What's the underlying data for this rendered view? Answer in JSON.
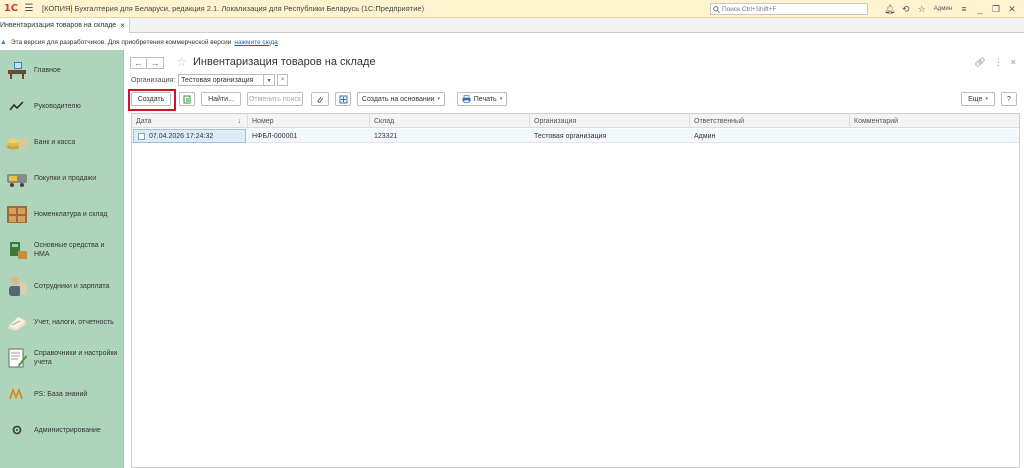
{
  "titlebar": {
    "logo_text": "1С",
    "title": "[КОПИЯ] Бухгалтерия для Беларуси, редакция 2.1. Локализация для Республики Беларусь  (1С:Предприятие)",
    "search_placeholder": "Поиск Ctrl+Shift+F",
    "user": "Админ"
  },
  "tabs": [
    {
      "label": "Инвентаризация товаров на складе"
    }
  ],
  "infobar": {
    "text": "Эта версия для разработчиков. Для приобретения коммерческой версии",
    "link": "нажмите сюда"
  },
  "sidebar": {
    "items": [
      {
        "label": "Главное",
        "icon": "desk-icon"
      },
      {
        "label": "Руководителю",
        "icon": "trend-icon"
      },
      {
        "label": "Банк и касса",
        "icon": "coins-icon"
      },
      {
        "label": "Покупки и продажи",
        "icon": "cart-icon"
      },
      {
        "label": "Номенклатура и склад",
        "icon": "warehouse-icon"
      },
      {
        "label": "Основные средства и НМА",
        "icon": "assets-icon"
      },
      {
        "label": "Сотрудники и зарплата",
        "icon": "people-icon"
      },
      {
        "label": "Учет, налоги, отчетность",
        "icon": "reports-icon"
      },
      {
        "label": "Справочники и настройки учета",
        "icon": "catalog-icon"
      },
      {
        "label": "PS: База знаний",
        "icon": "knowledge-icon"
      },
      {
        "label": "Администрирование",
        "icon": "gear-icon"
      }
    ]
  },
  "main": {
    "title": "Инвентаризация товаров на складе",
    "org_label": "Организация:",
    "org_value": "Тестовая организация",
    "toolbar": {
      "create": "Создать",
      "find": "Найти...",
      "cancel_search": "Отменить поиск",
      "create_based": "Создать на основании",
      "print": "Печать",
      "more": "Еще",
      "help": "?"
    },
    "columns": [
      "Дата",
      "Номер",
      "Склад",
      "Организация",
      "Ответственный",
      "Комментарий"
    ],
    "rows": [
      {
        "date": "07.04.2026 17:24:32",
        "number": "НФБЛ-000001",
        "warehouse": "123321",
        "org": "Тестовая организация",
        "responsible": "Админ",
        "comment": ""
      }
    ]
  },
  "colors": {
    "sidebar_bg": "#aed5bb",
    "titlebar_bg": "#fff4cf",
    "highlight": "#d1132a"
  }
}
